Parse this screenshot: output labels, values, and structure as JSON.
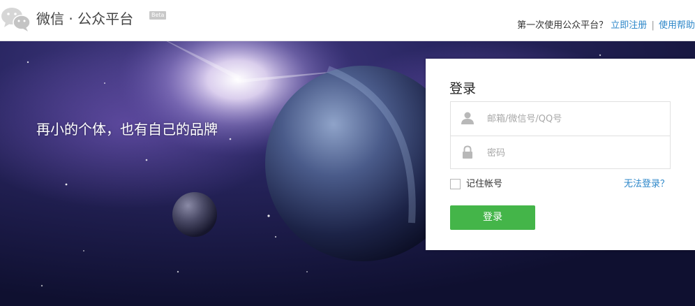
{
  "header": {
    "brand": "微信 · 公众平台",
    "badge": "Beta",
    "prompt": "第一次使用公众平台？",
    "register_link": "立即注册",
    "separator": "|",
    "help_link": "使用帮助"
  },
  "banner": {
    "slogan": "再小的个体，也有自己的品牌"
  },
  "login": {
    "title": "登录",
    "account_placeholder": "邮箱/微信号/QQ号",
    "account_value": "",
    "password_placeholder": "密码",
    "password_value": "",
    "remember_label": "记住帐号",
    "remember_checked": false,
    "forgot_link": "无法登录？",
    "submit_label": "登录"
  },
  "colors": {
    "link": "#2d87c9",
    "primary_button": "#44b549",
    "banner_background": "#1a1c48"
  },
  "icons": {
    "logo": "wechat-logo-icon",
    "account": "user-icon",
    "password": "lock-icon"
  }
}
